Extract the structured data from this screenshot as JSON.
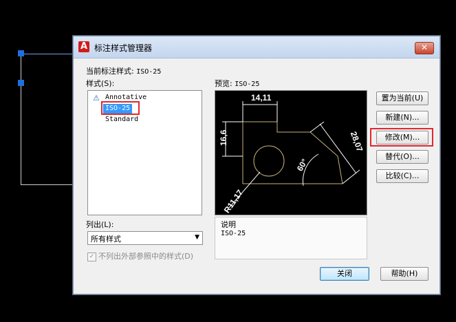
{
  "window": {
    "title": "标注样式管理器",
    "close_glyph": "✕"
  },
  "current_style": {
    "label": "当前标注样式:",
    "value": "ISO-25"
  },
  "styles": {
    "label": "样式(S):",
    "items": [
      "Annotative",
      "ISO-25",
      "Standard"
    ],
    "selected": "ISO-25"
  },
  "list_filter": {
    "label": "列出(L):",
    "value": "所有样式"
  },
  "exclude_xref": {
    "label": "不列出外部参照中的样式(D)",
    "checked": true
  },
  "preview": {
    "label": "预览:",
    "style": "ISO-25",
    "dim_top": "14,11",
    "dim_left": "16,6",
    "dim_right": "28,07",
    "dim_angle": "60°",
    "dim_radius": "R11,17"
  },
  "description": {
    "label": "说明",
    "text": "ISO-25"
  },
  "buttons": {
    "set_current": "置为当前(U)",
    "new": "新建(N)...",
    "modify": "修改(M)...",
    "override": "替代(O)...",
    "compare": "比较(C)...",
    "close": "关闭",
    "help": "帮助(H)"
  },
  "colors": {
    "highlight": "#e0282e",
    "selection": "#3399ff",
    "geometry": "#c9b27a"
  }
}
